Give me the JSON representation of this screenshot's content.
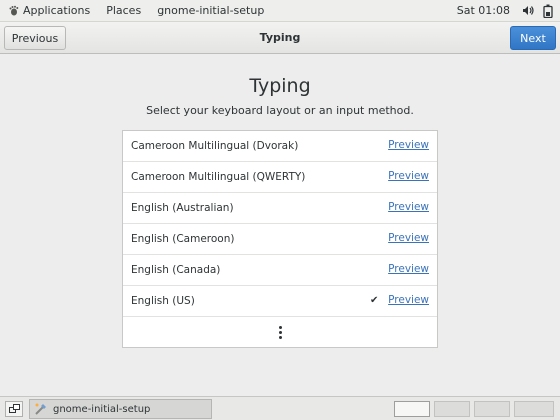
{
  "top_panel": {
    "applications_label": "Applications",
    "places_label": "Places",
    "app_menu_label": "gnome-initial-setup",
    "clock": "Sat 01:08",
    "icons": [
      "foot-icon",
      "volume-icon",
      "battery-icon"
    ]
  },
  "header": {
    "previous_label": "Previous",
    "title": "Typing",
    "next_label": "Next"
  },
  "main": {
    "title": "Typing",
    "subtitle": "Select your keyboard layout or an input method.",
    "layouts": [
      {
        "name": "Cameroon Multilingual (Dvorak)",
        "preview": "Preview",
        "selected": false
      },
      {
        "name": "Cameroon Multilingual (QWERTY)",
        "preview": "Preview",
        "selected": false
      },
      {
        "name": "English (Australian)",
        "preview": "Preview",
        "selected": false
      },
      {
        "name": "English (Cameroon)",
        "preview": "Preview",
        "selected": false
      },
      {
        "name": "English (Canada)",
        "preview": "Preview",
        "selected": false
      },
      {
        "name": "English (US)",
        "preview": "Preview",
        "selected": true
      }
    ],
    "check_glyph": "✔"
  },
  "taskbar": {
    "task_label": "gnome-initial-setup",
    "workspace_count": 4,
    "active_workspace": 1
  },
  "colors": {
    "accent": "#3176c6",
    "link": "#3b73b9",
    "background": "#ededed"
  }
}
